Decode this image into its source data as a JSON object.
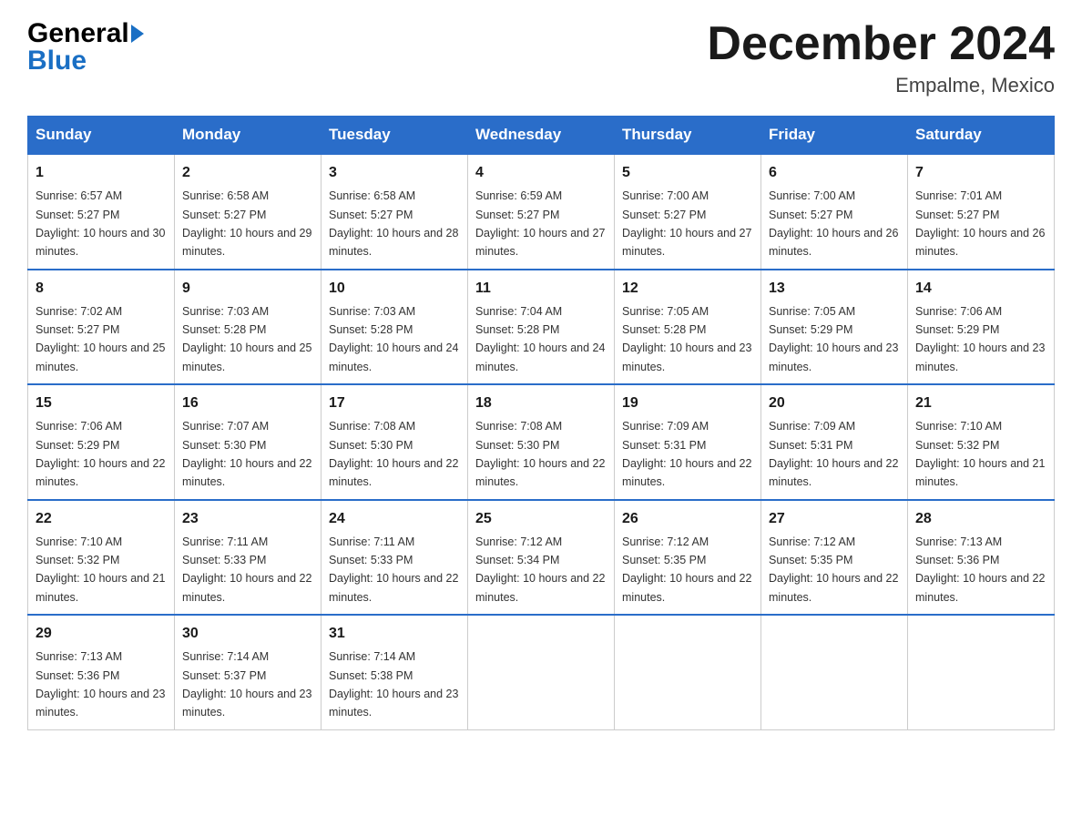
{
  "header": {
    "logo_line1": "General",
    "logo_line2": "Blue",
    "month_title": "December 2024",
    "location": "Empalme, Mexico"
  },
  "days_of_week": [
    "Sunday",
    "Monday",
    "Tuesday",
    "Wednesday",
    "Thursday",
    "Friday",
    "Saturday"
  ],
  "weeks": [
    [
      {
        "day": "1",
        "sunrise": "6:57 AM",
        "sunset": "5:27 PM",
        "daylight": "10 hours and 30 minutes."
      },
      {
        "day": "2",
        "sunrise": "6:58 AM",
        "sunset": "5:27 PM",
        "daylight": "10 hours and 29 minutes."
      },
      {
        "day": "3",
        "sunrise": "6:58 AM",
        "sunset": "5:27 PM",
        "daylight": "10 hours and 28 minutes."
      },
      {
        "day": "4",
        "sunrise": "6:59 AM",
        "sunset": "5:27 PM",
        "daylight": "10 hours and 27 minutes."
      },
      {
        "day": "5",
        "sunrise": "7:00 AM",
        "sunset": "5:27 PM",
        "daylight": "10 hours and 27 minutes."
      },
      {
        "day": "6",
        "sunrise": "7:00 AM",
        "sunset": "5:27 PM",
        "daylight": "10 hours and 26 minutes."
      },
      {
        "day": "7",
        "sunrise": "7:01 AM",
        "sunset": "5:27 PM",
        "daylight": "10 hours and 26 minutes."
      }
    ],
    [
      {
        "day": "8",
        "sunrise": "7:02 AM",
        "sunset": "5:27 PM",
        "daylight": "10 hours and 25 minutes."
      },
      {
        "day": "9",
        "sunrise": "7:03 AM",
        "sunset": "5:28 PM",
        "daylight": "10 hours and 25 minutes."
      },
      {
        "day": "10",
        "sunrise": "7:03 AM",
        "sunset": "5:28 PM",
        "daylight": "10 hours and 24 minutes."
      },
      {
        "day": "11",
        "sunrise": "7:04 AM",
        "sunset": "5:28 PM",
        "daylight": "10 hours and 24 minutes."
      },
      {
        "day": "12",
        "sunrise": "7:05 AM",
        "sunset": "5:28 PM",
        "daylight": "10 hours and 23 minutes."
      },
      {
        "day": "13",
        "sunrise": "7:05 AM",
        "sunset": "5:29 PM",
        "daylight": "10 hours and 23 minutes."
      },
      {
        "day": "14",
        "sunrise": "7:06 AM",
        "sunset": "5:29 PM",
        "daylight": "10 hours and 23 minutes."
      }
    ],
    [
      {
        "day": "15",
        "sunrise": "7:06 AM",
        "sunset": "5:29 PM",
        "daylight": "10 hours and 22 minutes."
      },
      {
        "day": "16",
        "sunrise": "7:07 AM",
        "sunset": "5:30 PM",
        "daylight": "10 hours and 22 minutes."
      },
      {
        "day": "17",
        "sunrise": "7:08 AM",
        "sunset": "5:30 PM",
        "daylight": "10 hours and 22 minutes."
      },
      {
        "day": "18",
        "sunrise": "7:08 AM",
        "sunset": "5:30 PM",
        "daylight": "10 hours and 22 minutes."
      },
      {
        "day": "19",
        "sunrise": "7:09 AM",
        "sunset": "5:31 PM",
        "daylight": "10 hours and 22 minutes."
      },
      {
        "day": "20",
        "sunrise": "7:09 AM",
        "sunset": "5:31 PM",
        "daylight": "10 hours and 22 minutes."
      },
      {
        "day": "21",
        "sunrise": "7:10 AM",
        "sunset": "5:32 PM",
        "daylight": "10 hours and 21 minutes."
      }
    ],
    [
      {
        "day": "22",
        "sunrise": "7:10 AM",
        "sunset": "5:32 PM",
        "daylight": "10 hours and 21 minutes."
      },
      {
        "day": "23",
        "sunrise": "7:11 AM",
        "sunset": "5:33 PM",
        "daylight": "10 hours and 22 minutes."
      },
      {
        "day": "24",
        "sunrise": "7:11 AM",
        "sunset": "5:33 PM",
        "daylight": "10 hours and 22 minutes."
      },
      {
        "day": "25",
        "sunrise": "7:12 AM",
        "sunset": "5:34 PM",
        "daylight": "10 hours and 22 minutes."
      },
      {
        "day": "26",
        "sunrise": "7:12 AM",
        "sunset": "5:35 PM",
        "daylight": "10 hours and 22 minutes."
      },
      {
        "day": "27",
        "sunrise": "7:12 AM",
        "sunset": "5:35 PM",
        "daylight": "10 hours and 22 minutes."
      },
      {
        "day": "28",
        "sunrise": "7:13 AM",
        "sunset": "5:36 PM",
        "daylight": "10 hours and 22 minutes."
      }
    ],
    [
      {
        "day": "29",
        "sunrise": "7:13 AM",
        "sunset": "5:36 PM",
        "daylight": "10 hours and 23 minutes."
      },
      {
        "day": "30",
        "sunrise": "7:14 AM",
        "sunset": "5:37 PM",
        "daylight": "10 hours and 23 minutes."
      },
      {
        "day": "31",
        "sunrise": "7:14 AM",
        "sunset": "5:38 PM",
        "daylight": "10 hours and 23 minutes."
      },
      null,
      null,
      null,
      null
    ]
  ]
}
